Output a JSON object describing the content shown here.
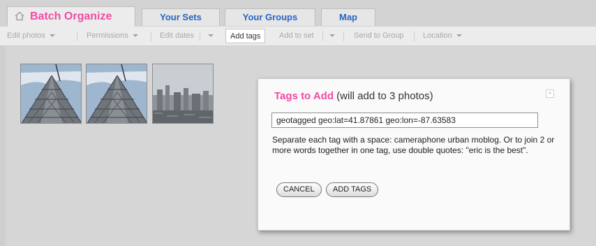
{
  "tabs": [
    {
      "label": "Batch Organize",
      "active": true,
      "icon": "home-icon"
    },
    {
      "label": "Your Sets",
      "active": false
    },
    {
      "label": "Your Groups",
      "active": false
    },
    {
      "label": "Map",
      "active": false
    }
  ],
  "subnav": [
    {
      "label": "Edit photos",
      "dropdown": true
    },
    {
      "label": "Permissions",
      "dropdown": true
    },
    {
      "label": "Edit dates",
      "dropdown": true
    },
    {
      "label": "Add tags",
      "dropdown": false,
      "active": true
    },
    {
      "label": "Add to set",
      "dropdown": true
    },
    {
      "label": "Send to Group",
      "dropdown": false
    },
    {
      "label": "Location",
      "dropdown": true
    }
  ],
  "thumbnails": [
    "building-photo",
    "building-photo",
    "skyline-photo"
  ],
  "dialog": {
    "title_highlight": "Tags to Add",
    "title_rest": "(will add to 3 photos)",
    "close_label": "×",
    "tag_value": "geotagged geo:lat=41.87861 geo:lon=-87.63583",
    "help_text": "Separate each tag with a space: cameraphone urban moblog. Or to join 2 or more words together in one tag, use double quotes: \"eric is the best\".",
    "cancel_label": "CANCEL",
    "add_label": "ADD TAGS"
  },
  "colors": {
    "accent_pink": "#f24ba6",
    "link_blue": "#2a63c2"
  }
}
